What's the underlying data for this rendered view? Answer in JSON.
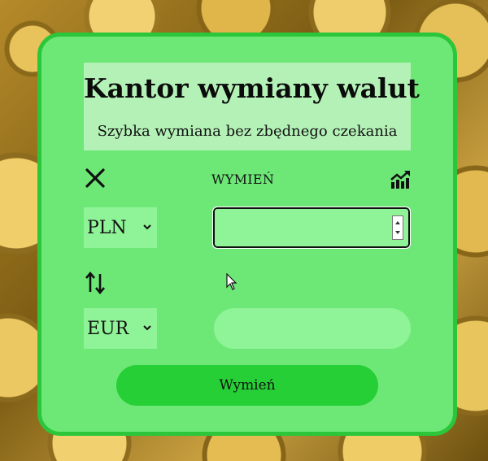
{
  "header": {
    "title": "Kantor wymiany walut",
    "subtitle": "Szybka wymiana bez zbędnego czekania"
  },
  "toolbar": {
    "close_icon": "close-icon",
    "exchange_label": "WYMIEŃ",
    "chart_icon": "trending-chart-icon"
  },
  "from": {
    "currency": "PLN",
    "amount_value": "",
    "amount_placeholder": ""
  },
  "swap_icon": "swap-vertical-icon",
  "to": {
    "currency": "EUR",
    "result_value": ""
  },
  "actions": {
    "submit_label": "Wymień"
  },
  "colors": {
    "card_background": "#6de877",
    "card_border": "#2bc63a",
    "header_background": "#b3f1b6",
    "field_background": "#8ff398",
    "button_background": "#26cf36"
  }
}
